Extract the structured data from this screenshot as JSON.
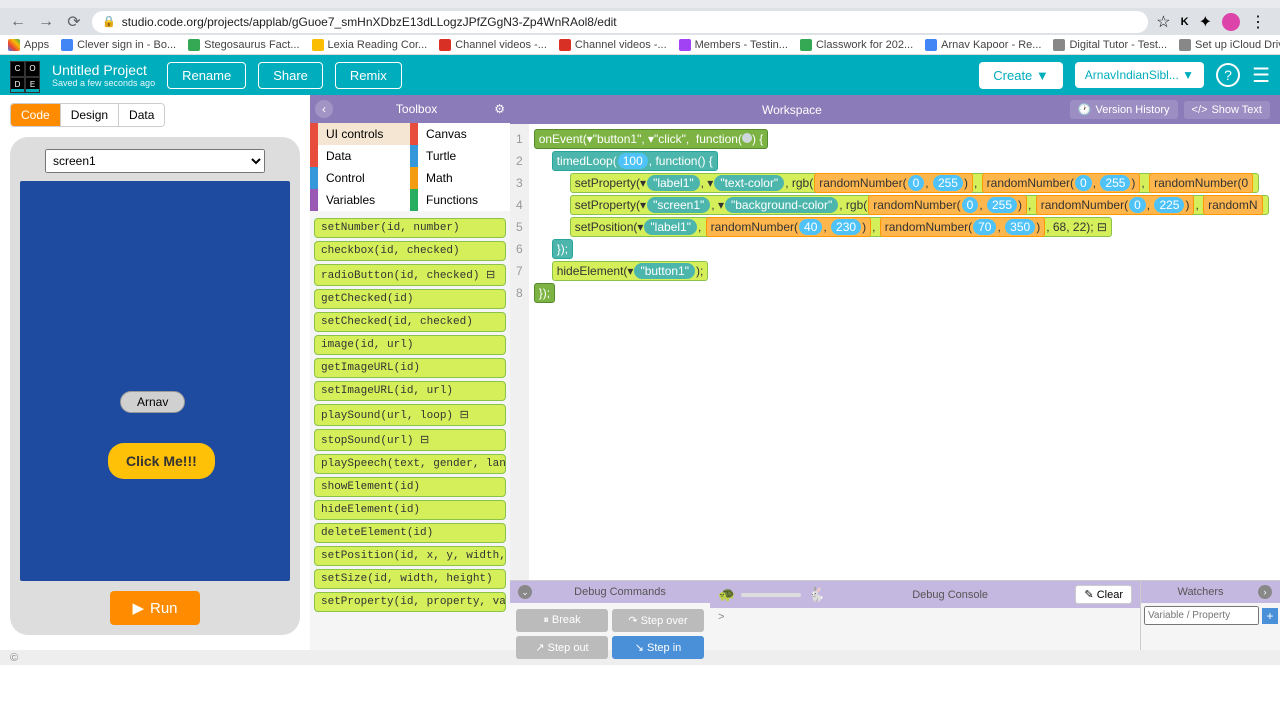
{
  "browser": {
    "url": "studio.code.org/projects/applab/gGuoe7_smHnXDbzE13dLLogzJPfZGgN3-Zp4WnRAol8/edit",
    "bookmarks": [
      "Apps",
      "Clever sign in - Bo...",
      "Stegosaurus Fact...",
      "Lexia Reading Cor...",
      "Channel videos -...",
      "Channel videos -...",
      "Members - Testin...",
      "Classwork for 202...",
      "Arnav Kapoor - Re...",
      "Digital Tutor - Test...",
      "Set up iCloud Driv..."
    ]
  },
  "header": {
    "project_title": "Untitled Project",
    "saved_text": "Saved a few seconds ago",
    "rename": "Rename",
    "share": "Share",
    "remix": "Remix",
    "create": "Create",
    "user": "ArnavIndianSibl..."
  },
  "tabs": {
    "code": "Code",
    "design": "Design",
    "data": "Data"
  },
  "phone": {
    "screen_select": "screen1",
    "label_text": "Arnav",
    "button_text": "Click Me!!!",
    "run": "Run"
  },
  "toolbox": {
    "title": "Toolbox",
    "categories": {
      "ui": "UI controls",
      "canvas": "Canvas",
      "data": "Data",
      "turtle": "Turtle",
      "control": "Control",
      "math": "Math",
      "vars": "Variables",
      "func": "Functions"
    },
    "blocks": [
      "setNumber(id, number)",
      "checkbox(id, checked)",
      "radioButton(id, checked) ⊟",
      "getChecked(id)",
      "setChecked(id, checked)",
      "image(id, url)",
      "getImageURL(id)",
      "setImageURL(id, url)",
      "playSound(url, loop) ⊟",
      "stopSound(url) ⊟",
      "playSpeech(text, gender, lan",
      "showElement(id)",
      "hideElement(id)",
      "deleteElement(id)",
      "setPosition(id, x, y, width,",
      "setSize(id, width, height)",
      "setProperty(id, property, va"
    ]
  },
  "workspace": {
    "title": "Workspace",
    "version_history": "Version History",
    "show_text": "Show Text",
    "line_numbers": [
      "1",
      "2",
      "3",
      "4",
      "5",
      "6",
      "7",
      "8"
    ],
    "code": {
      "l1": {
        "fn": "onEvent",
        "a1": "\"button1\"",
        "a2": "\"click\"",
        "kw": "function"
      },
      "l2": {
        "fn": "timedLoop",
        "n": "100",
        "kw": "function() {"
      },
      "l3": {
        "fn": "setProperty",
        "a1": "\"label1\"",
        "a2": "\"text-color\"",
        "rgb": "rgb(",
        "rn": "randomNumber(",
        "n0": "0",
        "n255": "255"
      },
      "l4": {
        "fn": "setProperty",
        "a1": "\"screen1\"",
        "a2": "\"background-color\"",
        "rgb": "rgb(",
        "rn": "randomNumber(",
        "n0": "0",
        "n255": "255",
        "n225": "225"
      },
      "l5": {
        "fn": "setPosition",
        "a1": "\"label1\"",
        "rn": "randomNumber(",
        "n40": "40",
        "n230": "230",
        "n70": "70",
        "n350": "350",
        "n68": "68",
        "n22": "22"
      },
      "l6": {
        "close": "});"
      },
      "l7": {
        "fn": "hideElement",
        "a1": "\"button1\""
      },
      "l8": {
        "close": "});"
      }
    }
  },
  "debug": {
    "commands_title": "Debug Commands",
    "console_title": "Debug Console",
    "watchers_title": "Watchers",
    "break": "Break",
    "step_over": "Step over",
    "step_out": "Step out",
    "step_in": "Step in",
    "clear": "Clear",
    "watch_placeholder": "Variable / Property",
    "prompt": ">"
  },
  "footer": {
    "copyright": "©"
  }
}
